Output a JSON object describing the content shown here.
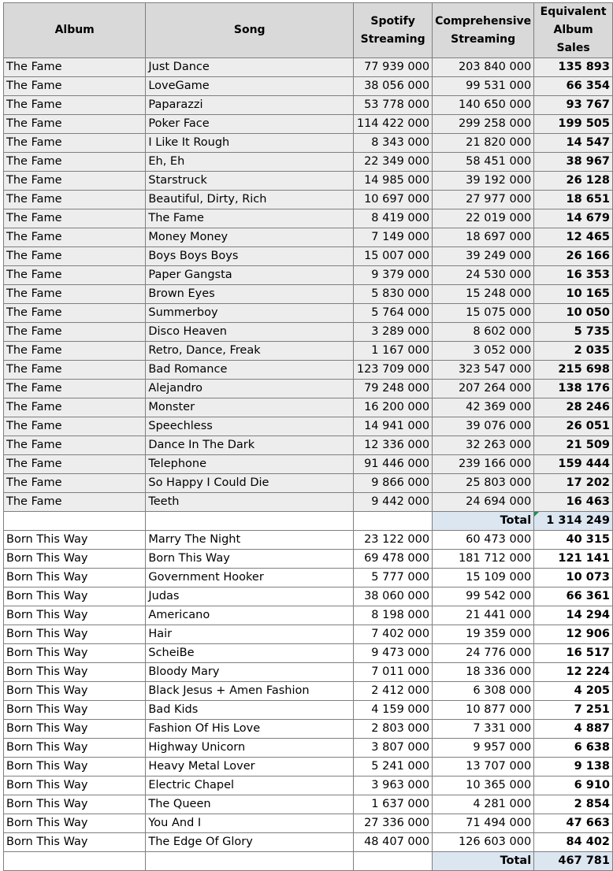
{
  "headers": {
    "album": "Album",
    "song": "Song",
    "spotify": "Spotify Streaming",
    "comprehensive": "Comprehensive Streaming",
    "equivalent": "Equivalent Album Sales"
  },
  "sections": [
    {
      "rows": [
        {
          "album": "The Fame",
          "song": "Just Dance",
          "spotify": "77 939 000",
          "comprehensive": "203 840 000",
          "sales": "135 893"
        },
        {
          "album": "The Fame",
          "song": "LoveGame",
          "spotify": "38 056 000",
          "comprehensive": "99 531 000",
          "sales": "66 354"
        },
        {
          "album": "The Fame",
          "song": "Paparazzi",
          "spotify": "53 778 000",
          "comprehensive": "140 650 000",
          "sales": "93 767"
        },
        {
          "album": "The Fame",
          "song": "Poker Face",
          "spotify": "114 422 000",
          "comprehensive": "299 258 000",
          "sales": "199 505"
        },
        {
          "album": "The Fame",
          "song": "I Like It Rough",
          "spotify": "8 343 000",
          "comprehensive": "21 820 000",
          "sales": "14 547"
        },
        {
          "album": "The Fame",
          "song": "Eh, Eh",
          "spotify": "22 349 000",
          "comprehensive": "58 451 000",
          "sales": "38 967"
        },
        {
          "album": "The Fame",
          "song": "Starstruck",
          "spotify": "14 985 000",
          "comprehensive": "39 192 000",
          "sales": "26 128"
        },
        {
          "album": "The Fame",
          "song": "Beautiful, Dirty, Rich",
          "spotify": "10 697 000",
          "comprehensive": "27 977 000",
          "sales": "18 651"
        },
        {
          "album": "The Fame",
          "song": "The Fame",
          "spotify": "8 419 000",
          "comprehensive": "22 019 000",
          "sales": "14 679"
        },
        {
          "album": "The Fame",
          "song": "Money Money",
          "spotify": "7 149 000",
          "comprehensive": "18 697 000",
          "sales": "12 465"
        },
        {
          "album": "The Fame",
          "song": "Boys Boys Boys",
          "spotify": "15 007 000",
          "comprehensive": "39 249 000",
          "sales": "26 166"
        },
        {
          "album": "The Fame",
          "song": "Paper Gangsta",
          "spotify": "9 379 000",
          "comprehensive": "24 530 000",
          "sales": "16 353"
        },
        {
          "album": "The Fame",
          "song": "Brown Eyes",
          "spotify": "5 830 000",
          "comprehensive": "15 248 000",
          "sales": "10 165"
        },
        {
          "album": "The Fame",
          "song": "Summerboy",
          "spotify": "5 764 000",
          "comprehensive": "15 075 000",
          "sales": "10 050"
        },
        {
          "album": "The Fame",
          "song": "Disco Heaven",
          "spotify": "3 289 000",
          "comprehensive": "8 602 000",
          "sales": "5 735"
        },
        {
          "album": "The Fame",
          "song": "Retro, Dance, Freak",
          "spotify": "1 167 000",
          "comprehensive": "3 052 000",
          "sales": "2 035"
        },
        {
          "album": "The Fame",
          "song": "Bad Romance",
          "spotify": "123 709 000",
          "comprehensive": "323 547 000",
          "sales": "215 698"
        },
        {
          "album": "The Fame",
          "song": "Alejandro",
          "spotify": "79 248 000",
          "comprehensive": "207 264 000",
          "sales": "138 176"
        },
        {
          "album": "The Fame",
          "song": "Monster",
          "spotify": "16 200 000",
          "comprehensive": "42 369 000",
          "sales": "28 246"
        },
        {
          "album": "The Fame",
          "song": "Speechless",
          "spotify": "14 941 000",
          "comprehensive": "39 076 000",
          "sales": "26 051"
        },
        {
          "album": "The Fame",
          "song": "Dance In The Dark",
          "spotify": "12 336 000",
          "comprehensive": "32 263 000",
          "sales": "21 509"
        },
        {
          "album": "The Fame",
          "song": "Telephone",
          "spotify": "91 446 000",
          "comprehensive": "239 166 000",
          "sales": "159 444"
        },
        {
          "album": "The Fame",
          "song": "So Happy I Could Die",
          "spotify": "9 866 000",
          "comprehensive": "25 803 000",
          "sales": "17 202"
        },
        {
          "album": "The Fame",
          "song": "Teeth",
          "spotify": "9 442 000",
          "comprehensive": "24 694 000",
          "sales": "16 463"
        }
      ],
      "total_label": "Total",
      "total_value": "1 314 249"
    },
    {
      "rows": [
        {
          "album": "Born This Way",
          "song": "Marry The Night",
          "spotify": "23 122 000",
          "comprehensive": "60 473 000",
          "sales": "40 315"
        },
        {
          "album": "Born This Way",
          "song": "Born This Way",
          "spotify": "69 478 000",
          "comprehensive": "181 712 000",
          "sales": "121 141"
        },
        {
          "album": "Born This Way",
          "song": "Government Hooker",
          "spotify": "5 777 000",
          "comprehensive": "15 109 000",
          "sales": "10 073"
        },
        {
          "album": "Born This Way",
          "song": "Judas",
          "spotify": "38 060 000",
          "comprehensive": "99 542 000",
          "sales": "66 361"
        },
        {
          "album": "Born This Way",
          "song": "Americano",
          "spotify": "8 198 000",
          "comprehensive": "21 441 000",
          "sales": "14 294"
        },
        {
          "album": "Born This Way",
          "song": "Hair",
          "spotify": "7 402 000",
          "comprehensive": "19 359 000",
          "sales": "12 906"
        },
        {
          "album": "Born This Way",
          "song": "ScheiBe",
          "spotify": "9 473 000",
          "comprehensive": "24 776 000",
          "sales": "16 517"
        },
        {
          "album": "Born This Way",
          "song": "Bloody Mary",
          "spotify": "7 011 000",
          "comprehensive": "18 336 000",
          "sales": "12 224"
        },
        {
          "album": "Born This Way",
          "song": "Black Jesus + Amen Fashion",
          "spotify": "2 412 000",
          "comprehensive": "6 308 000",
          "sales": "4 205"
        },
        {
          "album": "Born This Way",
          "song": "Bad Kids",
          "spotify": "4 159 000",
          "comprehensive": "10 877 000",
          "sales": "7 251"
        },
        {
          "album": "Born This Way",
          "song": "Fashion Of His Love",
          "spotify": "2 803 000",
          "comprehensive": "7 331 000",
          "sales": "4 887"
        },
        {
          "album": "Born This Way",
          "song": "Highway Unicorn",
          "spotify": "3 807 000",
          "comprehensive": "9 957 000",
          "sales": "6 638"
        },
        {
          "album": "Born This Way",
          "song": "Heavy Metal Lover",
          "spotify": "5 241 000",
          "comprehensive": "13 707 000",
          "sales": "9 138"
        },
        {
          "album": "Born This Way",
          "song": "Electric Chapel",
          "spotify": "3 963 000",
          "comprehensive": "10 365 000",
          "sales": "6 910"
        },
        {
          "album": "Born This Way",
          "song": "The Queen",
          "spotify": "1 637 000",
          "comprehensive": "4 281 000",
          "sales": "2 854"
        },
        {
          "album": "Born This Way",
          "song": "You And I",
          "spotify": "27 336 000",
          "comprehensive": "71 494 000",
          "sales": "47 663"
        },
        {
          "album": "Born This Way",
          "song": "The Edge Of Glory",
          "spotify": "48 407 000",
          "comprehensive": "126 603 000",
          "sales": "84 402"
        }
      ],
      "total_label": "Total",
      "total_value": "467 781"
    }
  ],
  "colors": {
    "header_bg": "#d9d9d9",
    "fame_row_bg": "#ededed",
    "btw_row_bg": "#ffffff",
    "total_bg": "#dce6f1",
    "gridline": "#7f7f7f",
    "cell_marker": "#1d8f4e"
  }
}
